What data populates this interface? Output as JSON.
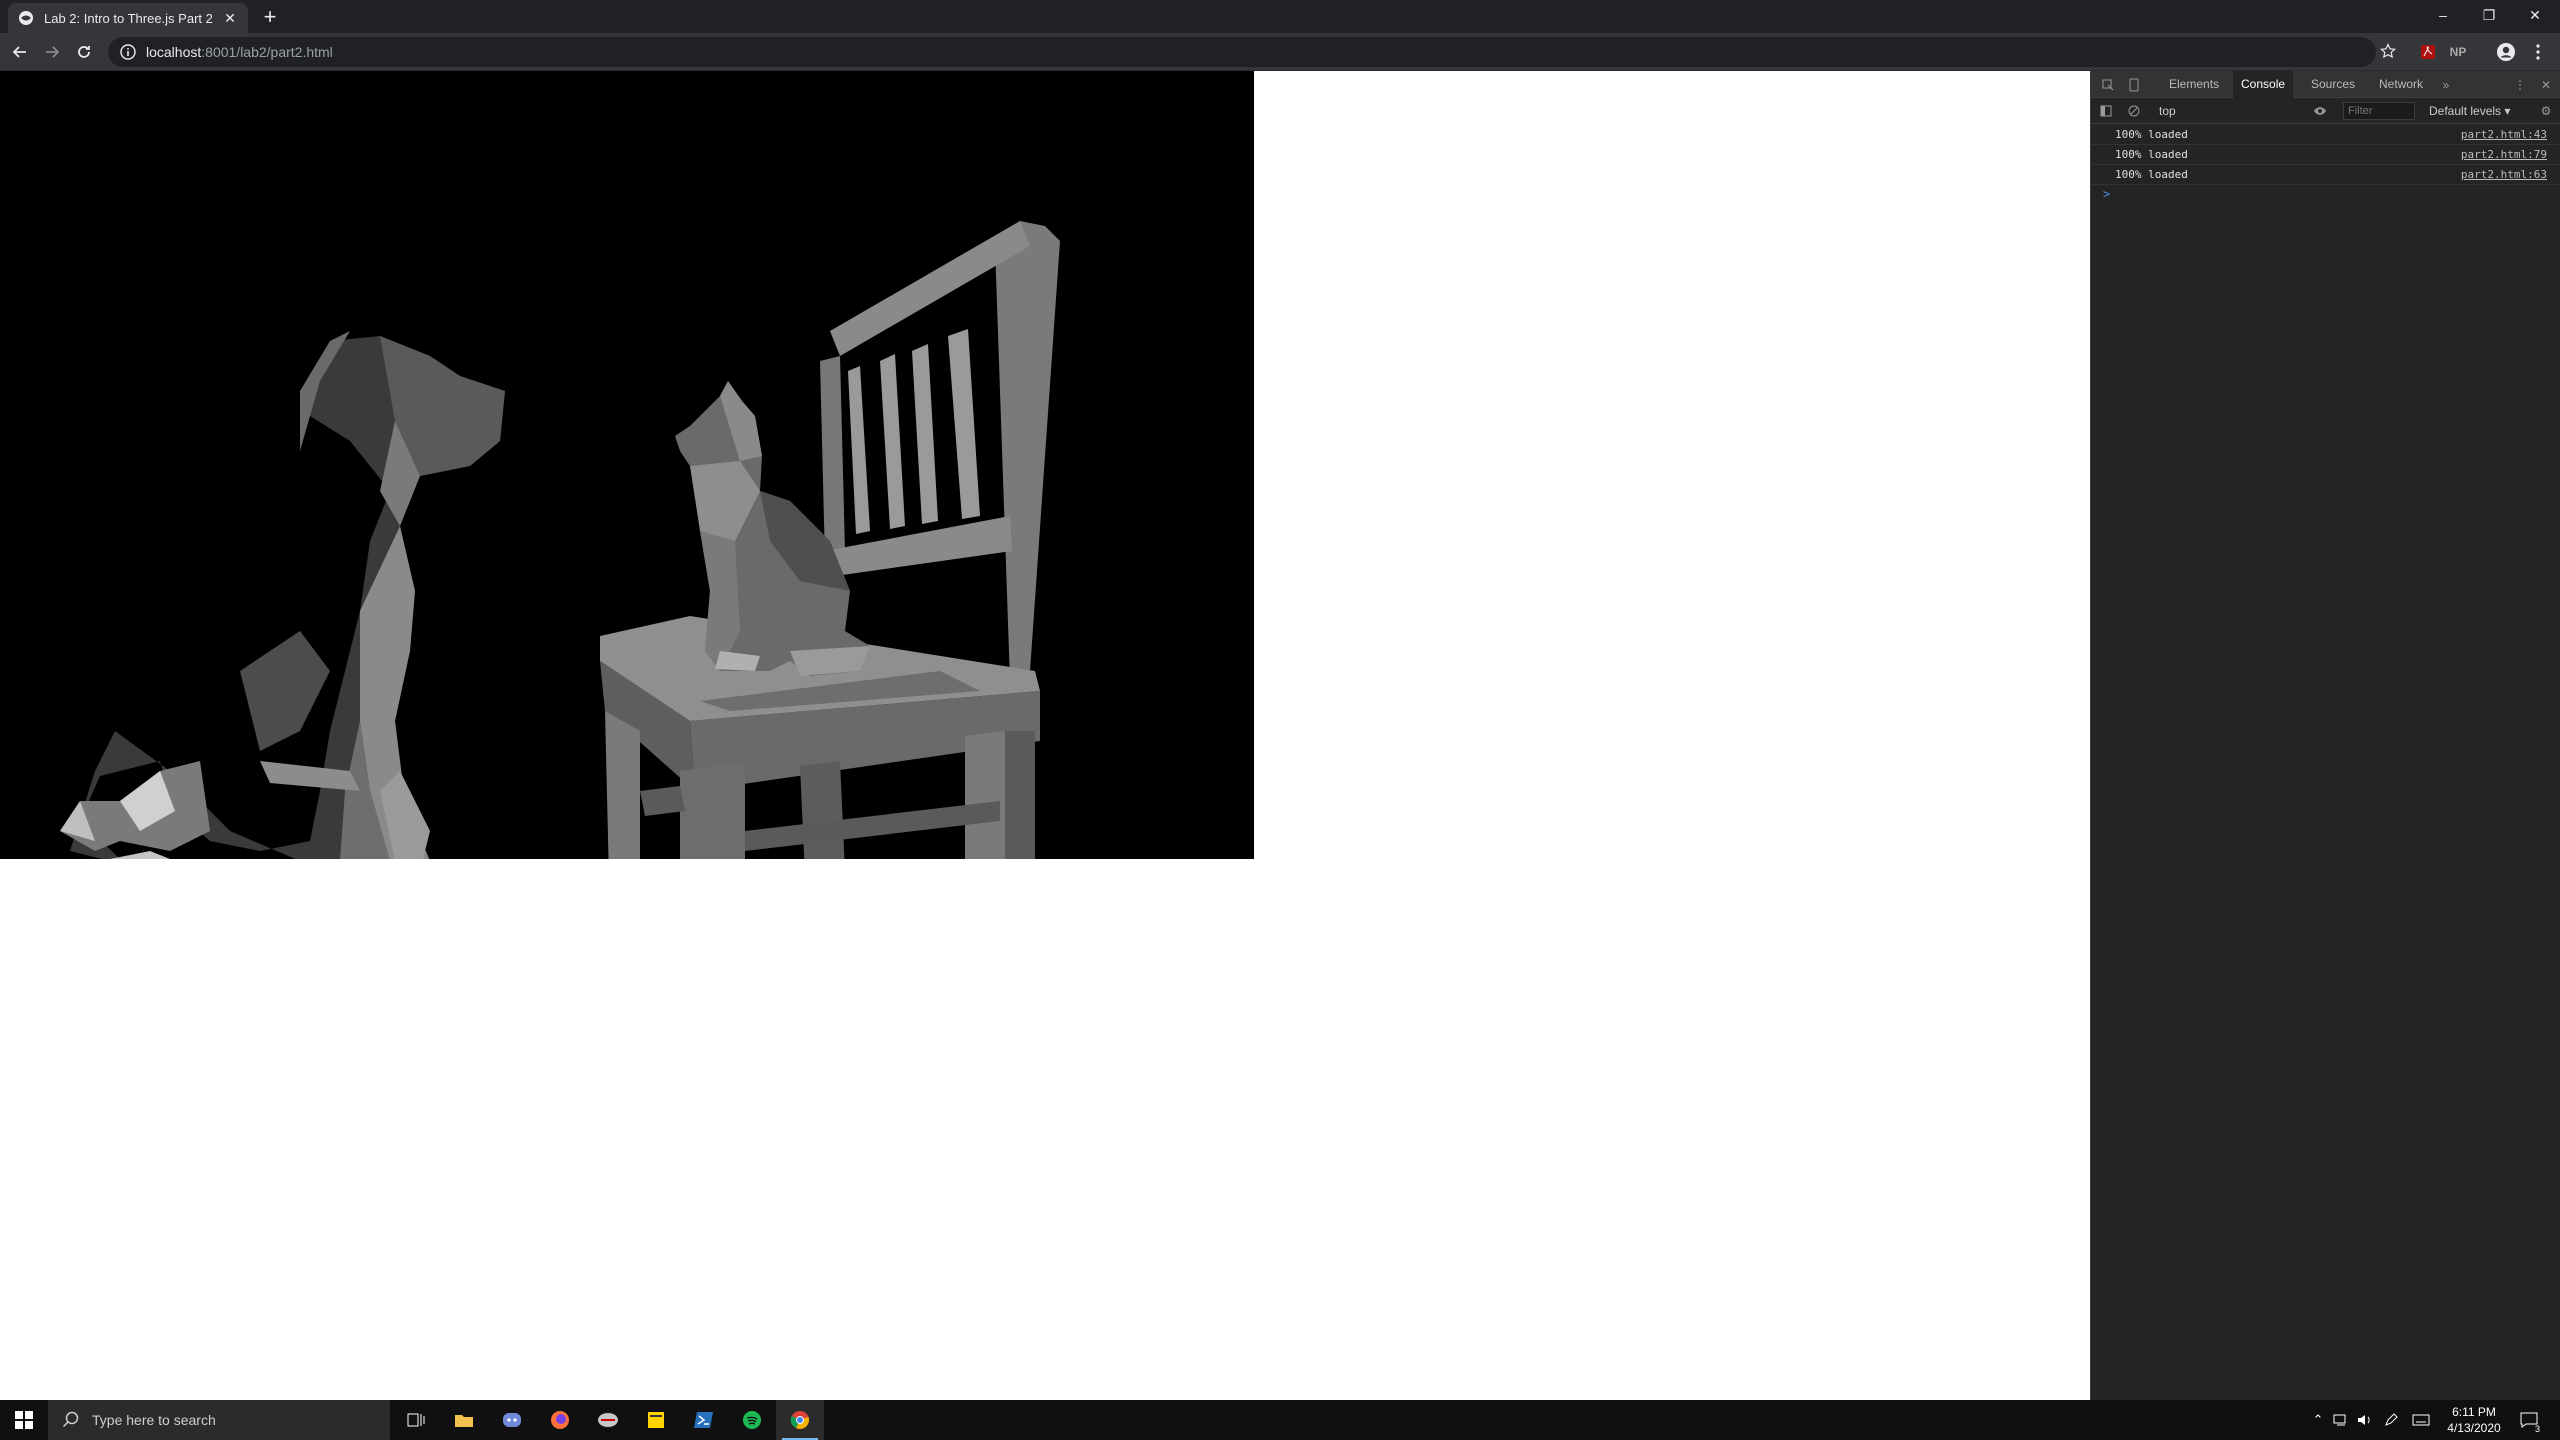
{
  "browser": {
    "tab_title": "Lab 2: Intro to Three.js Part 2",
    "url_host": "localhost",
    "url_rest": ":8001/lab2/part2.html",
    "ext_np": "NP"
  },
  "devtools": {
    "tabs": [
      "Elements",
      "Console",
      "Sources",
      "Network"
    ],
    "active_tab": "Console",
    "context": "top",
    "filter_placeholder": "Filter",
    "levels": "Default levels",
    "logs": [
      {
        "msg": "100% loaded",
        "src": "part2.html:43"
      },
      {
        "msg": "100% loaded",
        "src": "part2.html:79"
      },
      {
        "msg": "100% loaded",
        "src": "part2.html:63"
      }
    ],
    "prompt": ">"
  },
  "taskbar": {
    "search_placeholder": "Type here to search",
    "time": "6:11 PM",
    "date": "4/13/2020",
    "notification_count": "3"
  },
  "colors": {
    "chrome_dark": "#202124",
    "chrome_toolbar": "#35363a",
    "devtools_bg": "#242424",
    "canvas_bg": "#000000",
    "taskbar_bg": "#101010"
  }
}
